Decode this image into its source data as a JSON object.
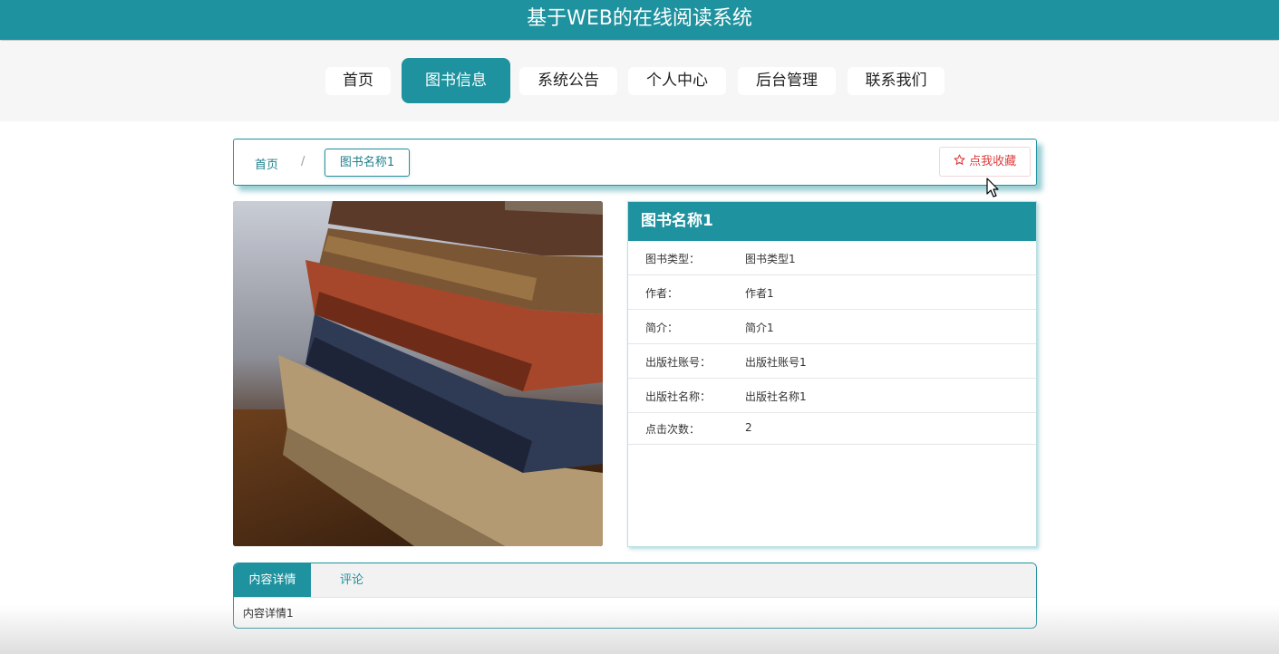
{
  "header": {
    "title": "基于WEB的在线阅读系统"
  },
  "nav": {
    "items": [
      {
        "label": "首页"
      },
      {
        "label": "图书信息"
      },
      {
        "label": "系统公告"
      },
      {
        "label": "个人中心"
      },
      {
        "label": "后台管理"
      },
      {
        "label": "联系我们"
      }
    ],
    "active": "图书信息"
  },
  "breadcrumb": {
    "home": "首页",
    "separator": "/",
    "current": "图书名称1"
  },
  "favorite_button": {
    "icon": "star-outline-icon",
    "label": "点我收藏"
  },
  "book": {
    "title": "图书名称1",
    "fields": [
      {
        "label": "图书类型：",
        "value": "图书类型1"
      },
      {
        "label": "作者：",
        "value": "作者1"
      },
      {
        "label": "简介：",
        "value": "简介1"
      },
      {
        "label": "出版社账号：",
        "value": "出版社账号1"
      },
      {
        "label": "出版社名称：",
        "value": "出版社名称1"
      },
      {
        "label": "点击次数：",
        "value": "2"
      }
    ]
  },
  "tabs": {
    "items": [
      {
        "label": "内容详情"
      },
      {
        "label": "评论"
      }
    ],
    "content": "内容详情1"
  },
  "colors": {
    "accent": "#1e929e",
    "favorite": "#e03c3c"
  }
}
